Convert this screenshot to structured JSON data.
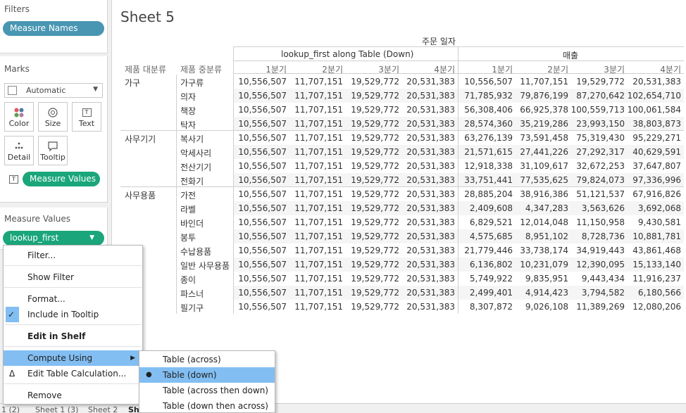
{
  "left": {
    "filters_title": "Filters",
    "filters_pill": "Measure Names",
    "marks_title": "Marks",
    "mark_type": "Automatic",
    "mark_buttons": [
      "Color",
      "Size",
      "Text",
      "Detail",
      "Tooltip"
    ],
    "measure_values_pill": "Measure Values",
    "measure_values_title": "Measure Values",
    "lookup_pill": "lookup_first"
  },
  "sheet": {
    "title": "Sheet 5",
    "top_header": "주문 일자",
    "group_headers": [
      "lookup_first along Table (Down)",
      "매출"
    ],
    "row_headers": [
      "제품 대분류",
      "제품 중분류"
    ],
    "quarters": [
      "1분기",
      "2분기",
      "3분기",
      "4분기",
      "1분기",
      "2분기",
      "3분기",
      "4분기"
    ],
    "rows": [
      {
        "cat": "가구",
        "sub": "가구류",
        "v": [
          "10,556,507",
          "11,707,151",
          "19,529,772",
          "20,531,383",
          "10,556,507",
          "11,707,151",
          "19,529,772",
          "20,531,383"
        ]
      },
      {
        "cat": "",
        "sub": "의자",
        "v": [
          "10,556,507",
          "11,707,151",
          "19,529,772",
          "20,531,383",
          "71,785,932",
          "79,876,199",
          "87,270,642",
          "102,654,710"
        ]
      },
      {
        "cat": "",
        "sub": "책장",
        "v": [
          "10,556,507",
          "11,707,151",
          "19,529,772",
          "20,531,383",
          "56,308,406",
          "66,925,378",
          "100,559,713",
          "100,061,584"
        ]
      },
      {
        "cat": "",
        "sub": "탁자",
        "v": [
          "10,556,507",
          "11,707,151",
          "19,529,772",
          "20,531,383",
          "28,574,360",
          "35,219,286",
          "23,993,150",
          "38,803,873"
        ]
      },
      {
        "cat": "사무기기",
        "sub": "복사기",
        "v": [
          "10,556,507",
          "11,707,151",
          "19,529,772",
          "20,531,383",
          "63,276,139",
          "73,591,458",
          "75,319,430",
          "95,229,271"
        ]
      },
      {
        "cat": "",
        "sub": "악세사리",
        "v": [
          "10,556,507",
          "11,707,151",
          "19,529,772",
          "20,531,383",
          "21,571,615",
          "27,441,226",
          "27,292,317",
          "40,629,591"
        ]
      },
      {
        "cat": "",
        "sub": "전산기기",
        "v": [
          "10,556,507",
          "11,707,151",
          "19,529,772",
          "20,531,383",
          "12,918,338",
          "31,109,617",
          "32,672,253",
          "37,647,807"
        ]
      },
      {
        "cat": "",
        "sub": "전화기",
        "v": [
          "10,556,507",
          "11,707,151",
          "19,529,772",
          "20,531,383",
          "33,751,441",
          "77,535,625",
          "79,824,073",
          "97,336,996"
        ]
      },
      {
        "cat": "사무용품",
        "sub": "가전",
        "v": [
          "10,556,507",
          "11,707,151",
          "19,529,772",
          "20,531,383",
          "28,885,204",
          "38,916,386",
          "51,121,537",
          "67,916,826"
        ]
      },
      {
        "cat": "",
        "sub": "라벨",
        "v": [
          "10,556,507",
          "11,707,151",
          "19,529,772",
          "20,531,383",
          "2,409,608",
          "4,347,283",
          "3,563,626",
          "3,692,068"
        ]
      },
      {
        "cat": "",
        "sub": "바인더",
        "v": [
          "10,556,507",
          "11,707,151",
          "19,529,772",
          "20,531,383",
          "6,829,521",
          "12,014,048",
          "11,150,958",
          "9,430,581"
        ]
      },
      {
        "cat": "",
        "sub": "봉투",
        "v": [
          "10,556,507",
          "11,707,151",
          "19,529,772",
          "20,531,383",
          "4,575,685",
          "8,951,102",
          "8,728,736",
          "10,881,781"
        ]
      },
      {
        "cat": "",
        "sub": "수납용품",
        "v": [
          "10,556,507",
          "11,707,151",
          "19,529,772",
          "20,531,383",
          "21,779,446",
          "33,738,174",
          "34,919,443",
          "43,861,468"
        ]
      },
      {
        "cat": "",
        "sub": "일반 사무용품",
        "v": [
          "10,556,507",
          "11,707,151",
          "19,529,772",
          "20,531,383",
          "6,136,802",
          "10,231,079",
          "12,390,095",
          "15,133,140"
        ]
      },
      {
        "cat": "",
        "sub": "종이",
        "v": [
          "10,556,507",
          "11,707,151",
          "19,529,772",
          "20,531,383",
          "5,749,922",
          "9,835,951",
          "9,443,434",
          "11,916,237"
        ]
      },
      {
        "cat": "",
        "sub": "파스너",
        "v": [
          "10,556,507",
          "11,707,151",
          "19,529,772",
          "20,531,383",
          "2,499,401",
          "4,914,423",
          "3,794,582",
          "6,180,566"
        ]
      },
      {
        "cat": "",
        "sub": "필기구",
        "v": [
          "10,556,507",
          "11,707,151",
          "19,529,772",
          "20,531,383",
          "8,307,872",
          "9,026,108",
          "11,389,269",
          "12,080,206"
        ]
      }
    ]
  },
  "tabs": [
    "1 (2)",
    "Sheet 1 (3)",
    "Sheet 2",
    "Sh"
  ],
  "context_menu": {
    "items": [
      {
        "label": "Filter...",
        "check": false,
        "bold": false,
        "selected": false
      },
      {
        "label": "Show Filter",
        "check": false,
        "bold": false,
        "selected": false
      },
      {
        "label": "Format...",
        "check": false,
        "bold": false,
        "selected": false
      },
      {
        "label": "Include in Tooltip",
        "check": true,
        "bold": false,
        "selected": false
      },
      {
        "label": "Edit in Shelf",
        "check": false,
        "bold": true,
        "selected": false
      },
      {
        "label": "Compute Using",
        "check": false,
        "bold": false,
        "selected": true,
        "submenu": true
      },
      {
        "label": "Edit Table Calculation...",
        "check": false,
        "bold": false,
        "selected": false,
        "delta": true
      },
      {
        "label": "Remove",
        "check": false,
        "bold": false,
        "selected": false
      }
    ],
    "submenu": [
      {
        "label": "Table (across)",
        "selected": false,
        "radio": false
      },
      {
        "label": "Table (down)",
        "selected": true,
        "radio": true
      },
      {
        "label": "Table (across then down)",
        "selected": false,
        "radio": false
      },
      {
        "label": "Table (down then across)",
        "selected": false,
        "radio": false
      }
    ]
  },
  "colors": {
    "pill_blue": "#4996b2",
    "pill_green": "#1aa67a",
    "menu_highlight": "#82bef2"
  }
}
